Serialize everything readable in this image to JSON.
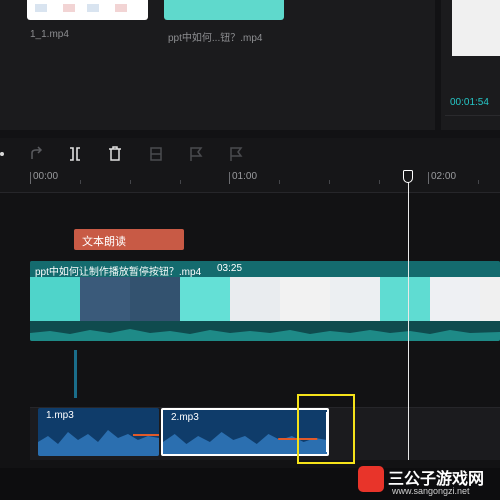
{
  "media": {
    "clips": [
      {
        "label": "1_1.mp4"
      },
      {
        "label": "ppt中如何...钮？.mp4"
      }
    ]
  },
  "preview": {
    "time": "00:01:54"
  },
  "toolbar": {
    "tools": [
      "undo-icon",
      "redo-icon",
      "split-icon",
      "delete-icon",
      "freeze-icon",
      "flag-icon",
      "flag-icon-2"
    ]
  },
  "ruler": {
    "ticks": [
      "00:00",
      "01:00",
      "02:00"
    ]
  },
  "tracks": {
    "text_clip": {
      "label": "文本朗读",
      "color": "#c85a45"
    },
    "video_clip": {
      "title": "ppt中如何让制作播放暂停按钮？.mp4",
      "duration": "03:25",
      "color": "#146b6e"
    },
    "audio_clips": [
      {
        "label": "1.mp3"
      },
      {
        "label": "2.mp3"
      }
    ]
  },
  "accent": {
    "playhead": "#e9e9e9",
    "highlight": "#f5e21a"
  },
  "watermark": {
    "title": "三公子游戏网",
    "url": "www.sangongzi.net"
  }
}
